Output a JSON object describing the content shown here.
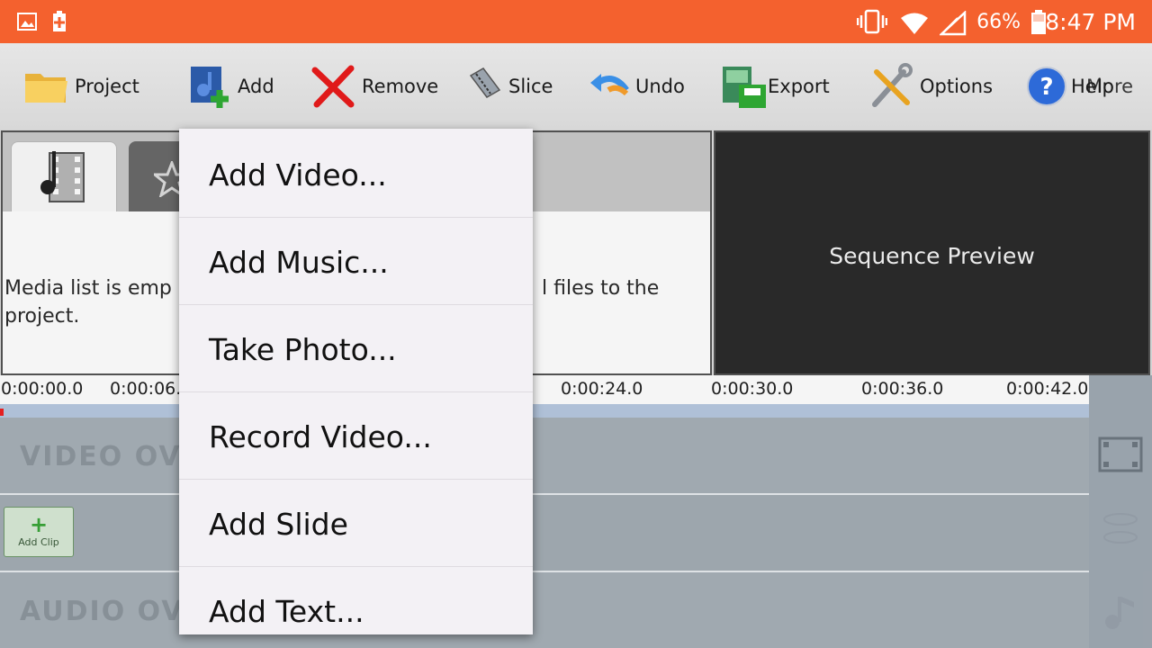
{
  "status_bar": {
    "battery_percent": "66%",
    "time": "8:47 PM",
    "background_color": "#f4612e"
  },
  "toolbar": {
    "buttons": [
      {
        "label": "Project",
        "icon": "folder-icon"
      },
      {
        "label": "Add",
        "icon": "add-media-icon"
      },
      {
        "label": "Remove",
        "icon": "red-x-icon"
      },
      {
        "label": "Slice",
        "icon": "slice-icon"
      },
      {
        "label": "Undo",
        "icon": "undo-arrow-icon"
      },
      {
        "label": "Export",
        "icon": "export-film-icon"
      },
      {
        "label": "Options",
        "icon": "tools-icon"
      },
      {
        "label": "Help",
        "icon": "help-icon"
      },
      {
        "label": "More",
        "icon": ""
      }
    ]
  },
  "media_panel": {
    "tabs": [
      "media-tab",
      "effects-tab"
    ],
    "empty_line1_start": "Media list is emp",
    "empty_line1_end": "l files to the",
    "empty_line2": "project."
  },
  "preview": {
    "label": "Sequence Preview"
  },
  "timeline": {
    "ticks": [
      "0:00:00.0",
      "0:00:06.",
      "0:00:24.0",
      "0:00:30.0",
      "0:00:36.0",
      "0:00:42.0"
    ],
    "video_track_label": "VIDEO OV",
    "audio_track_label": "AUDIO OV",
    "add_clip_label": "Add Clip"
  },
  "popup_menu": {
    "items": [
      "Add Video...",
      "Add Music...",
      "Take Photo...",
      "Record Video...",
      "Add Slide",
      "Add Text..."
    ]
  }
}
